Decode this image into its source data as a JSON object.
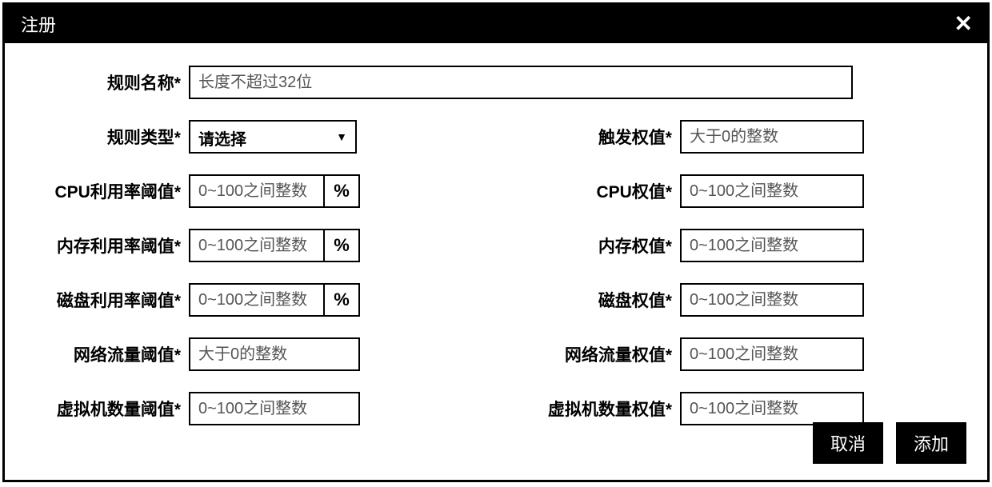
{
  "dialog": {
    "title": "注册"
  },
  "form": {
    "ruleName": {
      "label": "规则名称*",
      "placeholder": "长度不超过32位"
    },
    "ruleType": {
      "label": "规则类型*",
      "selected": "请选择"
    },
    "triggerWeight": {
      "label": "触发权值*",
      "placeholder": "大于0的整数"
    },
    "cpuThreshold": {
      "label": "CPU利用率阈值*",
      "placeholder": "0~100之间整数",
      "suffix": "%"
    },
    "cpuWeight": {
      "label": "CPU权值*",
      "placeholder": "0~100之间整数"
    },
    "memThreshold": {
      "label": "内存利用率阈值*",
      "placeholder": "0~100之间整数",
      "suffix": "%"
    },
    "memWeight": {
      "label": "内存权值*",
      "placeholder": "0~100之间整数"
    },
    "diskThreshold": {
      "label": "磁盘利用率阈值*",
      "placeholder": "0~100之间整数",
      "suffix": "%"
    },
    "diskWeight": {
      "label": "磁盘权值*",
      "placeholder": "0~100之间整数"
    },
    "netThreshold": {
      "label": "网络流量阈值*",
      "placeholder": "大于0的整数"
    },
    "netWeight": {
      "label": "网络流量权值*",
      "placeholder": "0~100之间整数"
    },
    "vmThreshold": {
      "label": "虚拟机数量阈值*",
      "placeholder": "0~100之间整数"
    },
    "vmWeight": {
      "label": "虚拟机数量权值*",
      "placeholder": "0~100之间整数"
    }
  },
  "buttons": {
    "cancel": "取消",
    "add": "添加"
  }
}
